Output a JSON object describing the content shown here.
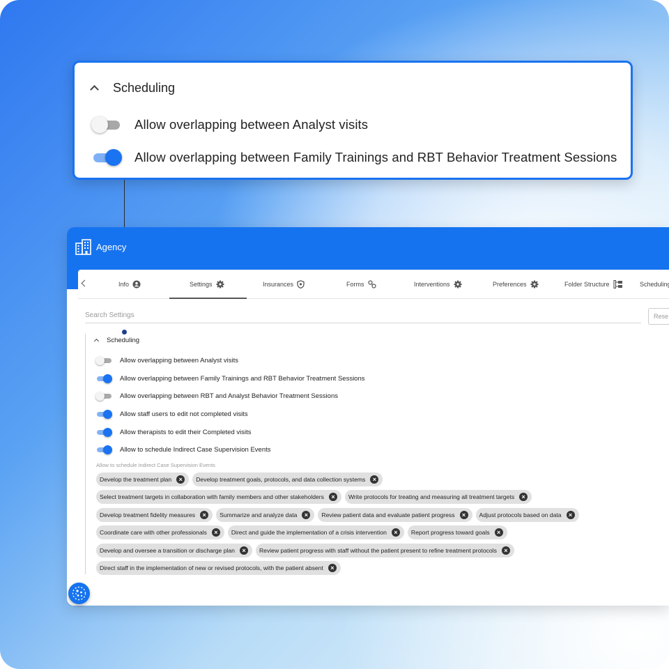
{
  "callout": {
    "section_title": "Scheduling",
    "toggles": [
      {
        "label": "Allow overlapping between Analyst visits",
        "on": false
      },
      {
        "label": "Allow overlapping between Family Trainings and RBT Behavior Treatment Sessions",
        "on": true
      }
    ]
  },
  "app": {
    "title": "Agency",
    "tabs": [
      {
        "label": "Info",
        "icon": "account-circle-icon"
      },
      {
        "label": "Settings",
        "icon": "gear-icon",
        "active": true
      },
      {
        "label": "Insurances",
        "icon": "shield-icon"
      },
      {
        "label": "Forms",
        "icon": "forms-icon"
      },
      {
        "label": "Interventions",
        "icon": "gear-icon"
      },
      {
        "label": "Preferences",
        "icon": "gear-icon"
      },
      {
        "label": "Folder Structure",
        "icon": "folder-tree-icon"
      },
      {
        "label": "Scheduling",
        "icon": ""
      }
    ],
    "search_placeholder": "Search Settings",
    "reset_label": "Rese",
    "section_title": "Scheduling",
    "toggles": [
      {
        "label": "Allow overlapping between Analyst visits",
        "on": false
      },
      {
        "label": "Allow overlapping between Family Trainings and RBT Behavior Treatment Sessions",
        "on": true
      },
      {
        "label": "Allow overlapping between RBT and Analyst Behavior Treatment Sessions",
        "on": false
      },
      {
        "label": "Allow staff users to edit not completed visits",
        "on": true
      },
      {
        "label": "Allow therapists to edit their Completed visits",
        "on": true
      },
      {
        "label": "Allow to schedule Indirect Case Supervision Events",
        "on": true
      }
    ],
    "chips_label": "Allow to schedule Indirect Case Supervision Events",
    "chip_rows": [
      [
        "Develop the treatment plan",
        "Develop treatment goals, protocols, and data collection systems"
      ],
      [
        "Select treatment targets in collaboration with family members and other stakeholders",
        "Write protocols for treating and measuring all treatment targets"
      ],
      [
        "Develop treatment fidelity measures",
        "Summarize and analyze data",
        "Review patient data and evaluate patient progress",
        "Adjust protocols based on data"
      ],
      [
        "Coordinate care with other professionals",
        "Direct and guide the implementation of a crisis intervention",
        "Report progress toward goals"
      ],
      [
        "Develop and oversee a transition or discharge plan",
        "Review patient progress with staff without the patient present to refine treatment protocols"
      ],
      [
        "Direct staff in the implementation of new or revised protocols, with the patient absent"
      ]
    ]
  },
  "colors": {
    "accent": "#1673f0",
    "chip_bg": "#e0e0e0"
  }
}
